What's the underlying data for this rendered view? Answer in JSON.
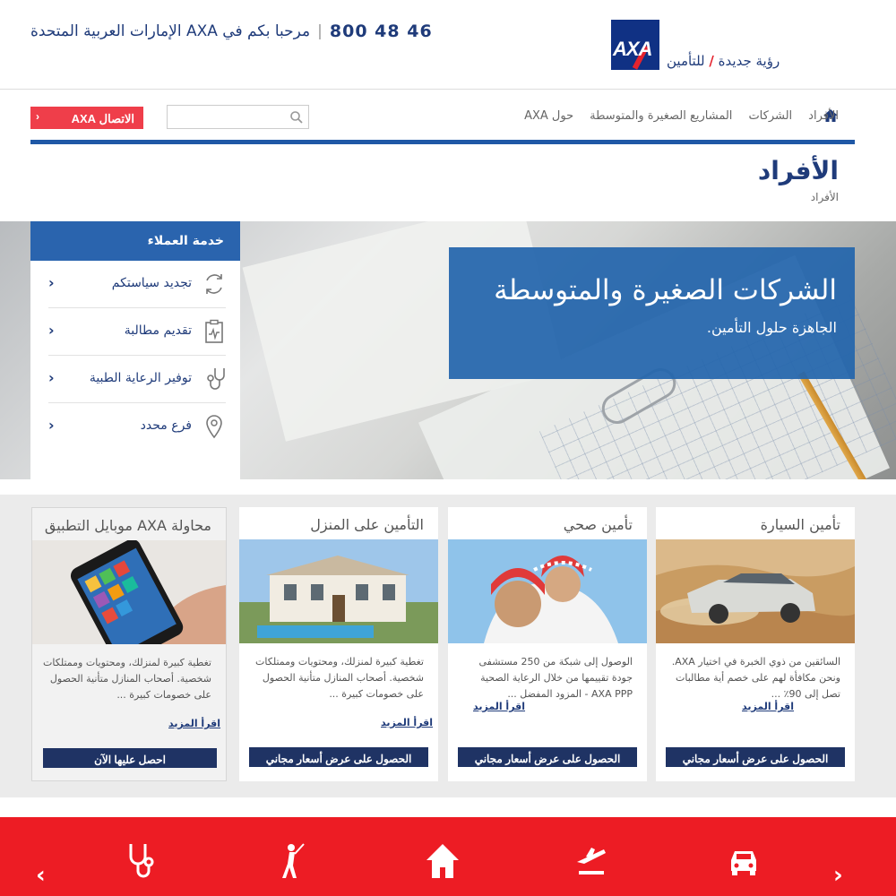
{
  "header": {
    "phone": "46 48 800",
    "welcome": "مرحبا بكم في AXA الإمارات العربية المتحدة",
    "logo_text": "AXA",
    "tagline_part1": "رؤية جديدة",
    "tagline_part2": "للتأمين"
  },
  "nav": {
    "items": [
      "الأفراد",
      "الشركات",
      "المشاريع الصغيرة والمتوسطة",
      "حول AXA"
    ],
    "contact_button": "الاتصال AXA",
    "search_placeholder": ""
  },
  "page": {
    "title": "الأفراد",
    "breadcrumb": "الأفراد"
  },
  "hero": {
    "title": "الشركات الصغيرة والمتوسطة",
    "subtitle": "الجاهزة حلول التأمين."
  },
  "customer_service": {
    "title": "خدمة العملاء",
    "items": [
      {
        "label": "تجديد سياستكم",
        "icon": "renew-icon"
      },
      {
        "label": "تقديم مطالبة",
        "icon": "claim-icon"
      },
      {
        "label": "توفير الرعاية الطبية",
        "icon": "stethoscope-icon"
      },
      {
        "label": "فرع محدد",
        "icon": "location-pin-icon"
      }
    ]
  },
  "products": [
    {
      "title": "تأمين السيارة",
      "text": "السائقين من ذوي الخبرة في اختيار AXA. ونحن مكافأة لهم على خصم أية مطالبات تصل إلى 90٪ ...",
      "more": "اقرأ المزيد",
      "button": "الحصول على عرض أسعار مجاني"
    },
    {
      "title": "تأمين صحي",
      "text": "الوصول إلى شبكة من 250 مستشفى جودة تقييمها من خلال الرعاية الصحية AXA PPP - المزود المفضل ...",
      "more": "اقرأ المزيد",
      "button": "الحصول على عرض أسعار مجاني"
    },
    {
      "title": "التأمين على المنزل",
      "text": "تغطية كبيرة لمنزلك، ومحتويات وممتلكات شخصية. أصحاب المنازل متأنية الحصول على خصومات كبيرة ...",
      "more": "اقرأ المزيد",
      "button": "الحصول على عرض أسعار مجاني"
    },
    {
      "title": "محاولة AXA موبايل التطبيق",
      "text": "تغطية كبيرة لمنزلك، ومحتويات وممتلكات شخصية. أصحاب المنازل متأنية الحصول على خصومات كبيرة ...",
      "more": "اقرأ المزيد",
      "button": "احصل عليها الآن"
    }
  ],
  "footer_bar": {
    "icons": [
      "car-icon",
      "plane-icon",
      "home-icon",
      "golf-icon",
      "stethoscope-icon"
    ],
    "prev": "‹",
    "next": "›"
  },
  "colors": {
    "brand_blue": "#103184",
    "nav_blue": "#1f58a6",
    "accent_red": "#ed1c24",
    "dark_button": "#1f3364"
  }
}
